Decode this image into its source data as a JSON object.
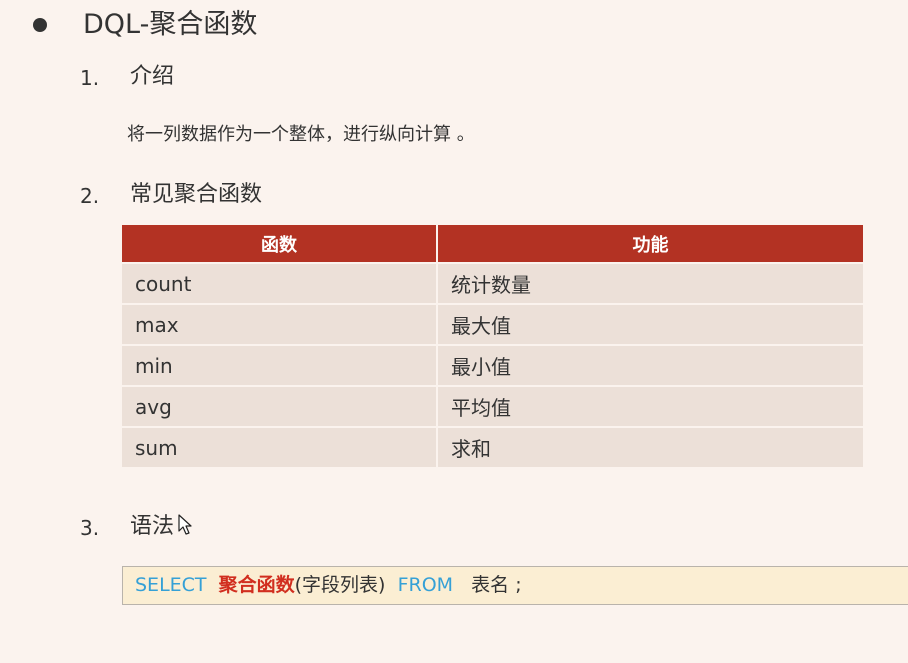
{
  "title": "DQL-聚合函数",
  "sections": [
    {
      "number": "1.",
      "title": "介绍",
      "text": "将一列数据作为一个整体，进行纵向计算 。"
    },
    {
      "number": "2.",
      "title": "常见聚合函数"
    },
    {
      "number": "3.",
      "title": "语法"
    }
  ],
  "table": {
    "headers": [
      "函数",
      "功能"
    ],
    "rows": [
      [
        "count",
        "统计数量"
      ],
      [
        "max",
        "最大值"
      ],
      [
        "min",
        "最小值"
      ],
      [
        "avg",
        "平均值"
      ],
      [
        "sum",
        "求和"
      ]
    ]
  },
  "syntax": {
    "select": "SELECT",
    "func": "聚合函数",
    "args": "(字段列表)",
    "from": "FROM",
    "table": "表名",
    "end": ";"
  },
  "colors": {
    "header_bg": "#b33223",
    "row_bg": "#ece0d8",
    "keyword": "#35a0d6",
    "function": "#d12e1f",
    "syntax_bg": "#fbeed3"
  }
}
